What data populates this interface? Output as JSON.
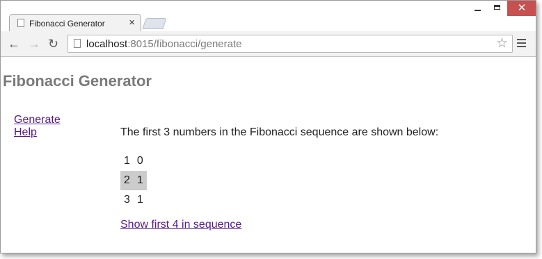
{
  "browser": {
    "tab_title": "Fibonacci Generator",
    "tab_close": "×",
    "window_close": "✕",
    "url_host": "localhost",
    "url_path": ":8015/fibonacci/generate"
  },
  "page": {
    "title": "Fibonacci Generator",
    "nav": [
      {
        "label": "Generate"
      },
      {
        "label": "Help"
      }
    ],
    "intro": "The first 3 numbers in the Fibonacci sequence are shown below:",
    "sequence": [
      {
        "index": "1",
        "value": "0"
      },
      {
        "index": "2",
        "value": "1"
      },
      {
        "index": "3",
        "value": "1"
      }
    ],
    "more_link": "Show first 4 in sequence"
  },
  "icons": {
    "back": "arrow-left",
    "forward": "arrow-right",
    "reload": "reload",
    "bookmark": "star",
    "menu": "hamburger"
  },
  "colors": {
    "title": "#7a7a7a",
    "link": "#551a8b",
    "row_highlight": "#cccccc",
    "window_close": "#c75050"
  }
}
